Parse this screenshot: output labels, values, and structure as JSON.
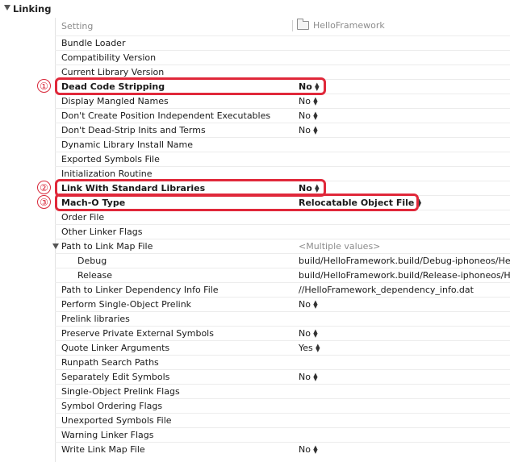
{
  "section": {
    "title": "Linking"
  },
  "columns": {
    "setting": "Setting",
    "target": "HelloFramework"
  },
  "rows": [
    {
      "name": "Bundle Loader",
      "value": ""
    },
    {
      "name": "Compatibility Version",
      "value": ""
    },
    {
      "name": "Current Library Version",
      "value": ""
    },
    {
      "name": "Dead Code Stripping",
      "value": "No"
    },
    {
      "name": "Display Mangled Names",
      "value": "No"
    },
    {
      "name": "Don't Create Position Independent Executables",
      "value": "No"
    },
    {
      "name": "Don't Dead-Strip Inits and Terms",
      "value": "No"
    },
    {
      "name": "Dynamic Library Install Name",
      "value": ""
    },
    {
      "name": "Exported Symbols File",
      "value": ""
    },
    {
      "name": "Initialization Routine",
      "value": ""
    },
    {
      "name": "Link With Standard Libraries",
      "value": "No"
    },
    {
      "name": "Mach-O Type",
      "value": "Relocatable Object File"
    },
    {
      "name": "Order File",
      "value": ""
    },
    {
      "name": "Other Linker Flags",
      "value": ""
    },
    {
      "name": "Path to Link Map File",
      "value": "<Multiple values>"
    },
    {
      "name": "Debug",
      "value": "build/HelloFramework.build/Debug-iphoneos/He"
    },
    {
      "name": "Release",
      "value": "build/HelloFramework.build/Release-iphoneos/H"
    },
    {
      "name": "Path to Linker Dependency Info File",
      "value": "//HelloFramework_dependency_info.dat"
    },
    {
      "name": "Perform Single-Object Prelink",
      "value": "No"
    },
    {
      "name": "Prelink libraries",
      "value": ""
    },
    {
      "name": "Preserve Private External Symbols",
      "value": "No"
    },
    {
      "name": "Quote Linker Arguments",
      "value": "Yes"
    },
    {
      "name": "Runpath Search Paths",
      "value": ""
    },
    {
      "name": "Separately Edit Symbols",
      "value": "No"
    },
    {
      "name": "Single-Object Prelink Flags",
      "value": ""
    },
    {
      "name": "Symbol Ordering Flags",
      "value": ""
    },
    {
      "name": "Unexported Symbols File",
      "value": ""
    },
    {
      "name": "Warning Linker Flags",
      "value": ""
    },
    {
      "name": "Write Link Map File",
      "value": "No"
    }
  ],
  "annotations": {
    "one": "①",
    "two": "②",
    "three": "③"
  },
  "colors": {
    "highlight": "#e0283a",
    "muted": "#8c8c8c"
  }
}
